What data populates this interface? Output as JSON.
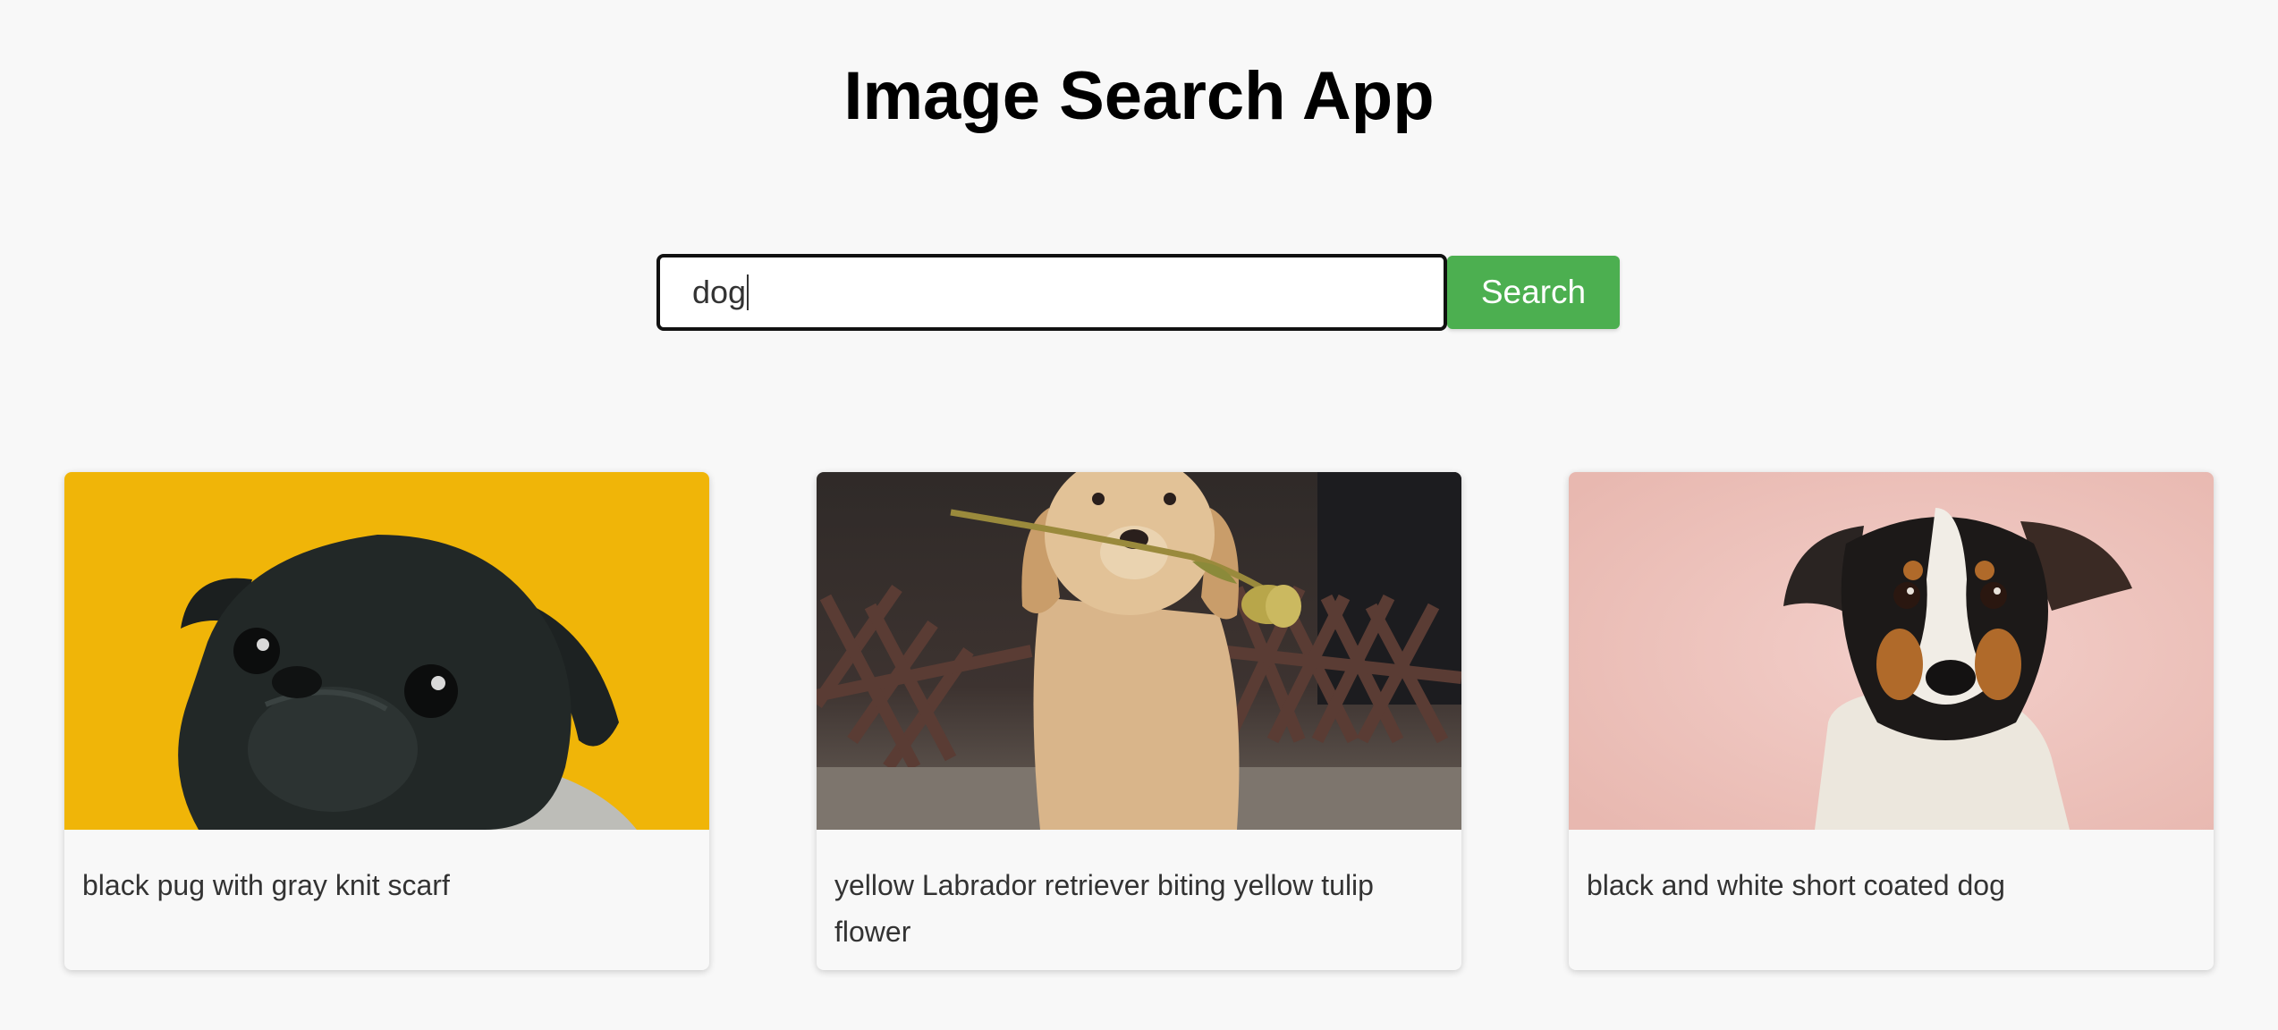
{
  "app": {
    "title": "Image Search App"
  },
  "search": {
    "value": "dog",
    "button_label": "Search"
  },
  "results": [
    {
      "caption": "black pug with gray knit scarf",
      "image_icon": "pug-photo",
      "bg": "#f0b508"
    },
    {
      "caption": "yellow Labrador retriever biting yellow tulip flower",
      "image_icon": "labrador-photo",
      "bg": "#3a3230"
    },
    {
      "caption": "black and white short coated dog",
      "image_icon": "terrier-photo",
      "bg": "#efc6c0"
    }
  ],
  "colors": {
    "accent": "#4caf50",
    "page_bg": "#f8f8f8"
  }
}
